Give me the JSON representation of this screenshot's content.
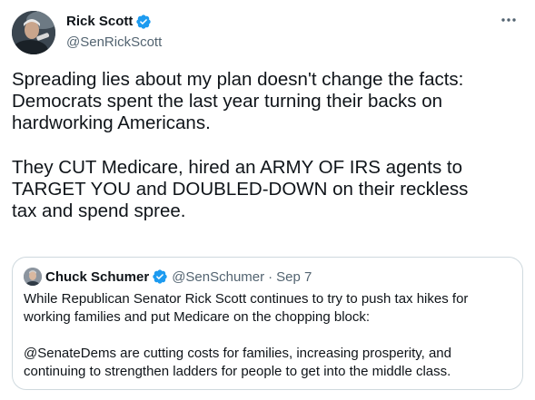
{
  "colors": {
    "text_primary": "#0f1419",
    "text_secondary": "#536471",
    "verified_blue": "#1d9bf0",
    "border": "#cfd9de"
  },
  "tweet": {
    "author": {
      "display_name": "Rick Scott",
      "handle": "@SenRickScott",
      "verified_icon": "verified-badge-icon"
    },
    "more_icon": "more-options-icon",
    "text_paragraphs": [
      "Spreading lies about my plan doesn't change the facts:\nDemocrats spent the last year turning their backs on\nhardworking Americans.",
      "They CUT Medicare, hired an ARMY OF IRS agents to\nTARGET YOU and DOUBLED-DOWN on their reckless\ntax and spend spree."
    ]
  },
  "quoted_tweet": {
    "author": {
      "display_name": "Chuck Schumer",
      "handle": "@SenSchumer",
      "separator": "·",
      "date": "Sep 7"
    },
    "text_paragraphs": [
      "While Republican Senator Rick Scott continues to try to push tax hikes for working families and put Medicare on the chopping block:",
      "@SenateDems are cutting costs for families, increasing prosperity, and continuing to strengthen ladders for people to get into the middle class."
    ]
  }
}
